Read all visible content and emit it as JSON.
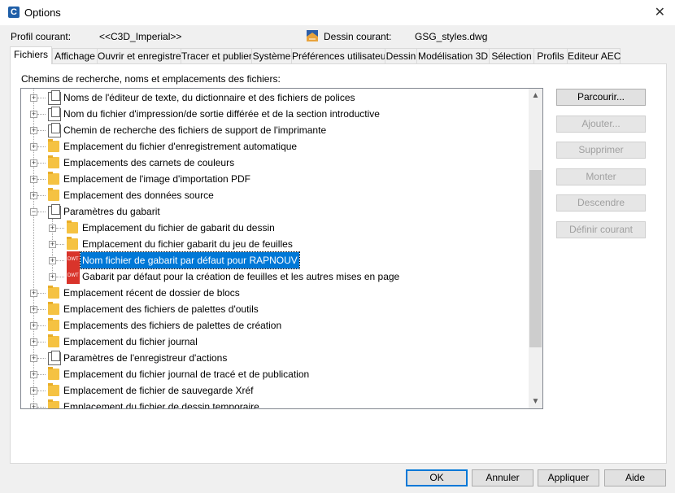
{
  "window": {
    "title": "Options",
    "app_icon": "C"
  },
  "profile": {
    "label": "Profil courant:",
    "value": "<<C3D_Imperial>>"
  },
  "drawing": {
    "label": "Dessin courant:",
    "value": "GSG_styles.dwg"
  },
  "tabs": [
    "Fichiers",
    "Affichage",
    "Ouvrir et enregistrer",
    "Tracer et publier",
    "Système",
    "Préférences utilisateur",
    "Dessin",
    "Modélisation 3D",
    "Sélection",
    "Profils",
    "Editeur AEC"
  ],
  "section_label": "Chemins de recherche, noms et emplacements des fichiers:",
  "tree": [
    "Noms de l'éditeur de texte, du dictionnaire et des fichiers de polices",
    "Nom du fichier d'impression/de sortie différée et de la section introductive",
    "Chemin de recherche des fichiers de support de l'imprimante",
    "Emplacement du fichier d'enregistrement automatique",
    "Emplacements des carnets de couleurs",
    "Emplacement de l'image d'importation PDF",
    "Emplacement des données source",
    "Paramètres du gabarit",
    "Emplacement du fichier de gabarit du dessin",
    "Emplacement du fichier gabarit du jeu de feuilles",
    "Nom fichier de gabarit par défaut pour RAPNOUV",
    "Gabarit par défaut pour la création de feuilles et les autres mises en page",
    "Emplacement récent de dossier de blocs",
    "Emplacement des fichiers de palettes d'outils",
    "Emplacements des fichiers de palettes de création",
    "Emplacement du fichier journal",
    "Paramètres de l'enregistreur d'actions",
    "Emplacement du fichier journal de tracé et de publication",
    "Emplacement de fichier de sauvegarde Xréf",
    "Emplacement du fichier de dessin temporaire"
  ],
  "side_buttons": {
    "browse": "Parcourir...",
    "add": "Ajouter...",
    "remove": "Supprimer",
    "up": "Monter",
    "down": "Descendre",
    "set_current": "Définir courant"
  },
  "bottom_buttons": {
    "ok": "OK",
    "cancel": "Annuler",
    "apply": "Appliquer",
    "help": "Aide"
  }
}
